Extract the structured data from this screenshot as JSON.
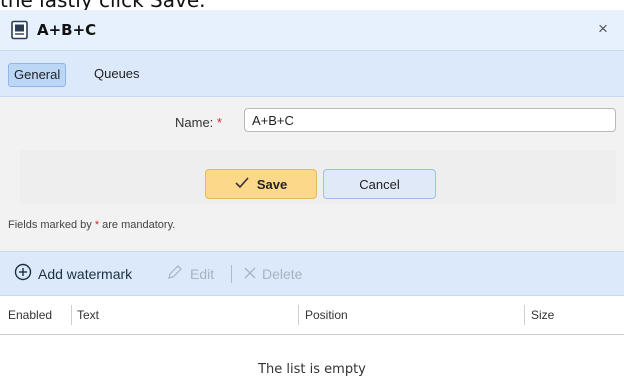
{
  "top_instruction": "the lastly click Save.",
  "dialog": {
    "title": "A+B+C",
    "close_glyph": "×"
  },
  "tabs": [
    {
      "label": "General",
      "active": true
    },
    {
      "label": "Queues",
      "active": false
    }
  ],
  "form": {
    "name_label": "Name:",
    "required_marker": "*",
    "name_value": "A+B+C",
    "save_label": "Save",
    "cancel_label": "Cancel",
    "note_prefix": "Fields marked by ",
    "note_marker": "*",
    "note_suffix": " are mandatory."
  },
  "toolbar": {
    "add_label": "Add watermark",
    "edit_label": "Edit",
    "delete_label": "Delete"
  },
  "table": {
    "columns": [
      "Enabled",
      "Text",
      "Position",
      "Size"
    ],
    "empty_message": "The list is empty"
  },
  "colors": {
    "accent": "#dbe9fb",
    "save_button": "#fbd88a",
    "required": "#d9262c"
  }
}
